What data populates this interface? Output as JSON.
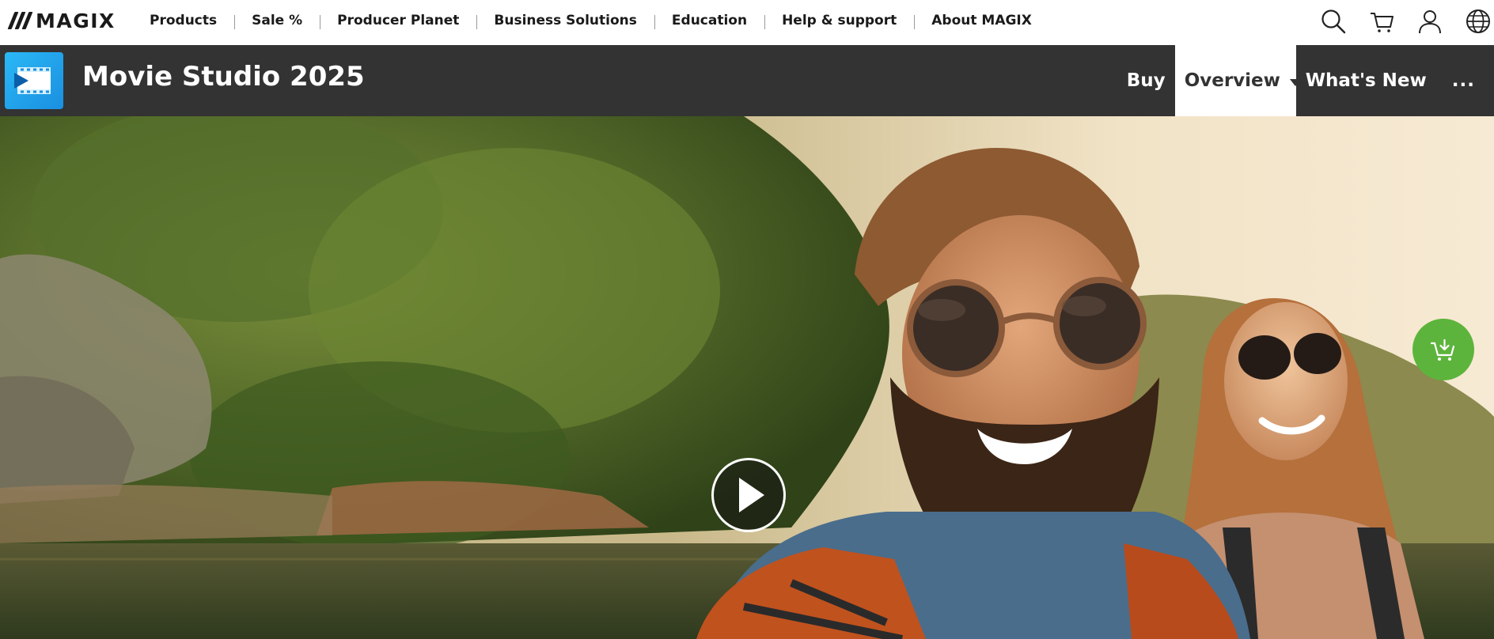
{
  "brand": {
    "name": "MAGIX"
  },
  "topnav": {
    "links": [
      "Products",
      "Sale %",
      "Producer Planet",
      "Business Solutions",
      "Education",
      "Help & support",
      "About MAGIX"
    ],
    "icons": [
      "search-icon",
      "cart-icon",
      "user-icon",
      "globe-icon"
    ]
  },
  "product": {
    "title": "Movie Studio 2025",
    "nav": {
      "buy": "Buy",
      "overview": "Overview",
      "whats_new": "What's New",
      "more": "..."
    }
  },
  "hero": {
    "play_icon": "play-icon",
    "cart_fab_icon": "add-to-cart-icon"
  },
  "colors": {
    "accent_green": "#5db43c",
    "bar_dark": "#333333",
    "app_icon_blue": "#1a8fe0"
  }
}
